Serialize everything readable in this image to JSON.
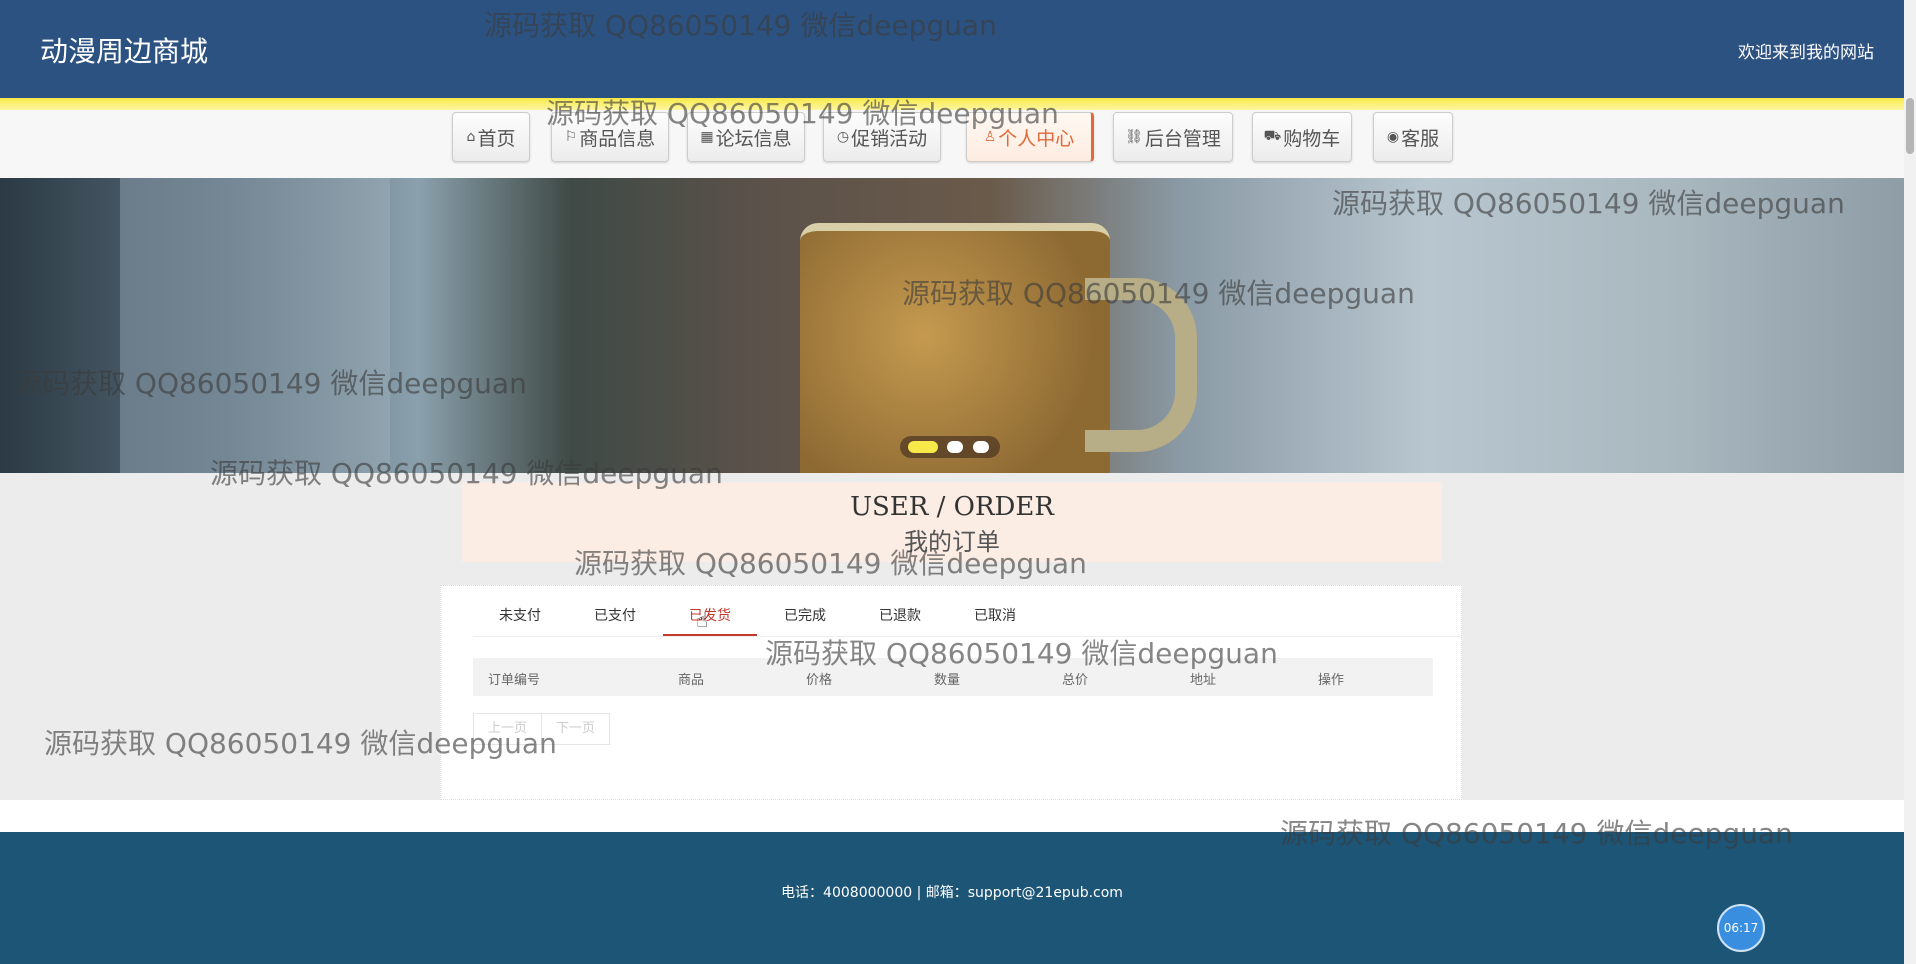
{
  "header": {
    "logo": "动漫周边商城",
    "welcome": "欢迎来到我的网站"
  },
  "nav": {
    "items": [
      {
        "icon": "home-icon",
        "label": "首页"
      },
      {
        "icon": "flag-icon",
        "label": "商品信息"
      },
      {
        "icon": "forum-icon",
        "label": "论坛信息"
      },
      {
        "icon": "clock-icon",
        "label": "促销活动"
      },
      {
        "icon": "user-icon",
        "label": "个人中心",
        "active": true
      },
      {
        "icon": "link-icon",
        "label": "后台管理"
      },
      {
        "icon": "cart-icon",
        "label": "购物车"
      },
      {
        "icon": "service-icon",
        "label": "客服"
      }
    ]
  },
  "banner": {
    "slides": 3,
    "active_slide": 1
  },
  "page_title": {
    "en": "USER / ORDER",
    "cn": "我的订单"
  },
  "tabs": [
    {
      "label": "未支付"
    },
    {
      "label": "已支付"
    },
    {
      "label": "已发货",
      "active": true
    },
    {
      "label": "已完成"
    },
    {
      "label": "已退款"
    },
    {
      "label": "已取消"
    }
  ],
  "table": {
    "columns": [
      "订单编号",
      "商品",
      "价格",
      "数量",
      "总价",
      "地址",
      "操作"
    ]
  },
  "pager": {
    "prev": "上一页",
    "next": "下一页"
  },
  "footer": {
    "contact": "电话：4008000000 | 邮箱：support@21epub.com"
  },
  "clock": {
    "time": "06:17"
  },
  "watermark": "源码获取 QQ86050149 微信deepguan",
  "colors": {
    "header_bg": "#2c5282",
    "footer_bg": "#1d5577",
    "active_tab": "#c0392b",
    "active_nav": "#e0693a"
  }
}
